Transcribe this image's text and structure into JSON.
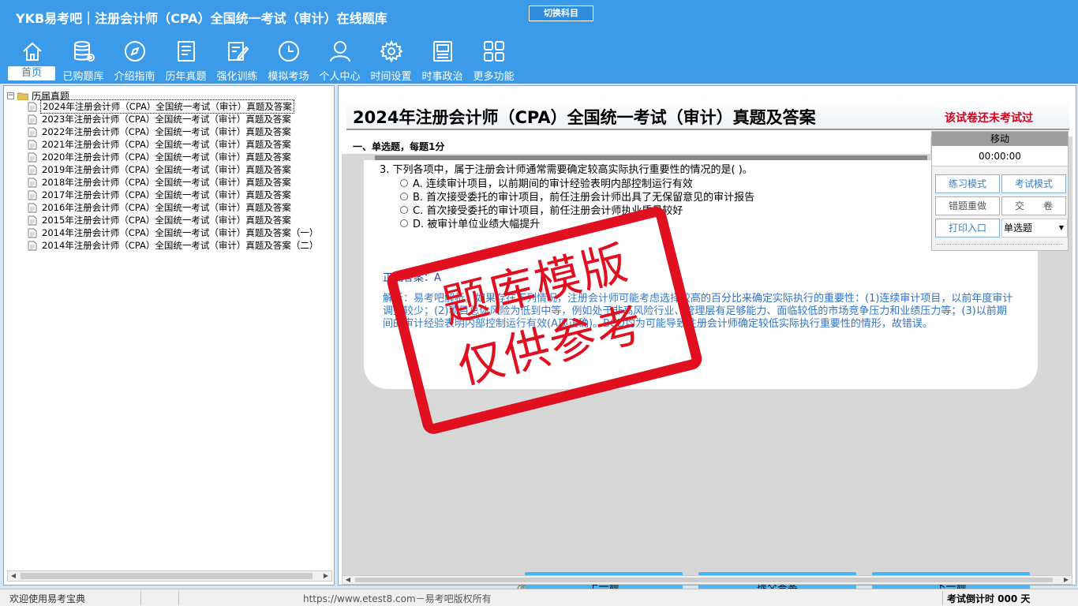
{
  "app": {
    "title": "YKB易考吧｜注册会计师（CPA）全国统一考试（审计）在线题库",
    "switch_subject": "切换科目"
  },
  "nav": [
    {
      "label": "首页",
      "icon": "home-icon"
    },
    {
      "label": "已购题库",
      "icon": "database-icon"
    },
    {
      "label": "介绍指南",
      "icon": "compass-icon"
    },
    {
      "label": "历年真题",
      "icon": "list-doc-icon"
    },
    {
      "label": "强化训练",
      "icon": "edit-icon"
    },
    {
      "label": "模拟考场",
      "icon": "clock-icon"
    },
    {
      "label": "个人中心",
      "icon": "user-icon"
    },
    {
      "label": "时间设置",
      "icon": "gear-icon"
    },
    {
      "label": "时事政治",
      "icon": "newspaper-icon"
    },
    {
      "label": "更多功能",
      "icon": "grid-icon"
    }
  ],
  "tree": {
    "root": "历届真题",
    "items": [
      "2024年注册会计师（CPA）全国统一考试（审计）真题及答案",
      "2023年注册会计师（CPA）全国统一考试（审计）真题及答案",
      "2022年注册会计师（CPA）全国统一考试（审计）真题及答案",
      "2021年注册会计师（CPA）全国统一考试（审计）真题及答案",
      "2020年注册会计师（CPA）全国统一考试（审计）真题及答案",
      "2019年注册会计师（CPA）全国统一考试（审计）真题及答案",
      "2018年注册会计师（CPA）全国统一考试（审计）真题及答案",
      "2017年注册会计师（CPA）全国统一考试（审计）真题及答案",
      "2016年注册会计师（CPA）全国统一考试（审计）真题及答案",
      "2015年注册会计师（CPA）全国统一考试（审计）真题及答案",
      "2014年注册会计师（CPA）全国统一考试（审计）真题及答案（一）",
      "2014年注册会计师（CPA）全国统一考试（审计）真题及答案（二）"
    ]
  },
  "paper": {
    "title": "2024年注册会计师（CPA）全国统一考试（审计）真题及答案",
    "status": "该试卷还未考试过",
    "section": "一、单选题，每题1分"
  },
  "question": {
    "text": "3. 下列各项中，属于注册会计师通常需要确定较高实际执行重要性的情况的是( )。",
    "options": [
      "A. 连续审计项目，以前期间的审计经验表明内部控制运行有效",
      "B. 首次接受委托的审计项目，前任注册会计师出具了无保留意见的审计报告",
      "C. 首次接受委托的审计项目，前任注册会计师执业质量较好",
      "D. 被审计单位业绩大幅提升"
    ],
    "answer": "正确答案：A",
    "analysis": "解析：易考吧解析，如果存在下列情况，注册会计师可能考虑选择较高的百分比来确定实际执行的重要性：(1)连续审计项目，以前年度审计调整较少；(2)项目总体风险为低到中等，例如处于非高风险行业、管理层有足够能力、面临较低的市场竞争压力和业绩压力等；(3)以前期间的审计经验表明内部控制运行有效(A项正确)。BCD均为可能导致注册会计师确定较低实际执行重要性的情形，故错误。"
  },
  "controls": {
    "move": "移动",
    "timer": "00:00:00",
    "practice_mode": "练习模式",
    "exam_mode": "考试模式",
    "redo_wrong": "错题重做",
    "submit_paper": "交　　卷",
    "print": "打印入口",
    "question_type": "单选题"
  },
  "buttons": {
    "prev": "上一题",
    "submit": "提交答案",
    "next": "下一题"
  },
  "watermark": {
    "line1": "题库模版",
    "line2": "仅供参考"
  },
  "status": {
    "welcome": "欢迎使用易考宝典",
    "copyright": "https://www.etest8.com－易考吧版权所有",
    "countdown": "考试倒计时 000 天"
  }
}
